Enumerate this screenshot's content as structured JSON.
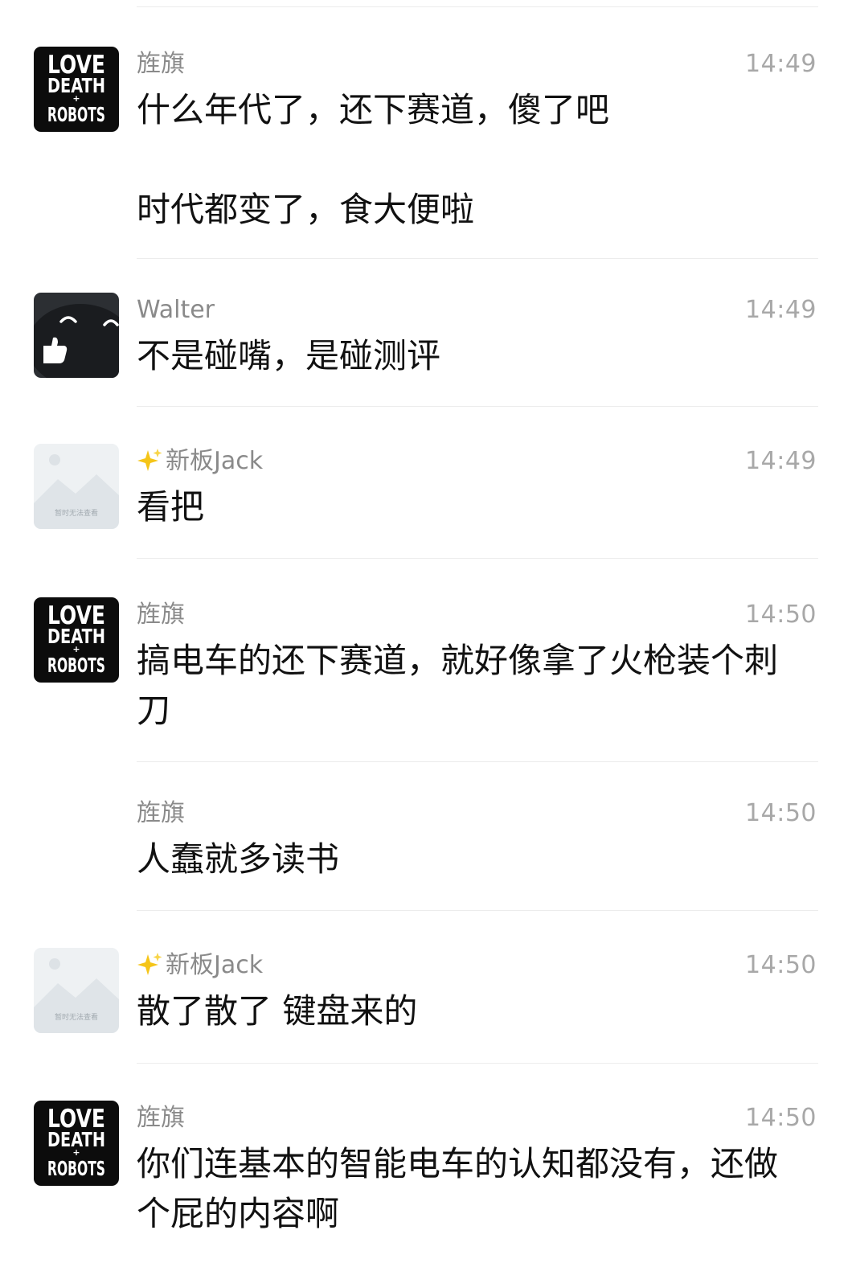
{
  "messages": [
    {
      "sender": "旌旗",
      "time": "14:49",
      "avatar": "love-death-robots-logo",
      "avatar_text": [
        "LOVE",
        "DEATH",
        "+",
        "ROBOTS"
      ],
      "lines": [
        "什么年代了，还下赛道，傻了吧",
        "",
        "时代都变了，食大便啦"
      ]
    },
    {
      "sender": "Walter",
      "time": "14:49",
      "avatar": "dark-smiley-thumbs-up",
      "lines": [
        "不是碰嘴，是碰测评"
      ]
    },
    {
      "sender": "新板Jack",
      "sender_prefix_icon": "sparkles-icon",
      "time": "14:49",
      "avatar": "image-unavailable-placeholder",
      "avatar_text": "暂时无法查看",
      "lines": [
        "看把"
      ]
    },
    {
      "sender": "旌旗",
      "time": "14:50",
      "avatar": "love-death-robots-logo",
      "avatar_text": [
        "LOVE",
        "DEATH",
        "+",
        "ROBOTS"
      ],
      "lines": [
        "搞电车的还下赛道，就好像拿了火枪装个刺",
        "刀"
      ]
    },
    {
      "sender": "旌旗",
      "time": "14:50",
      "avatar": "none",
      "lines": [
        "人蠢就多读书"
      ]
    },
    {
      "sender": "新板Jack",
      "sender_prefix_icon": "sparkles-icon",
      "time": "14:50",
      "avatar": "image-unavailable-placeholder",
      "avatar_text": "暂时无法查看",
      "lines": [
        "散了散了 键盘来的"
      ]
    },
    {
      "sender": "旌旗",
      "time": "14:50",
      "avatar": "love-death-robots-logo",
      "avatar_text": [
        "LOVE",
        "DEATH",
        "+",
        "ROBOTS"
      ],
      "lines": [
        "你们连基本的智能电车的认知都没有，还做",
        "个屁的内容啊"
      ]
    }
  ],
  "colors": {
    "background": "#ffffff",
    "sender_name": "#8a8a8a",
    "timestamp": "#a8a8a8",
    "message_text": "#111111",
    "separator": "#ececec",
    "sparkle": "#f5c518"
  }
}
